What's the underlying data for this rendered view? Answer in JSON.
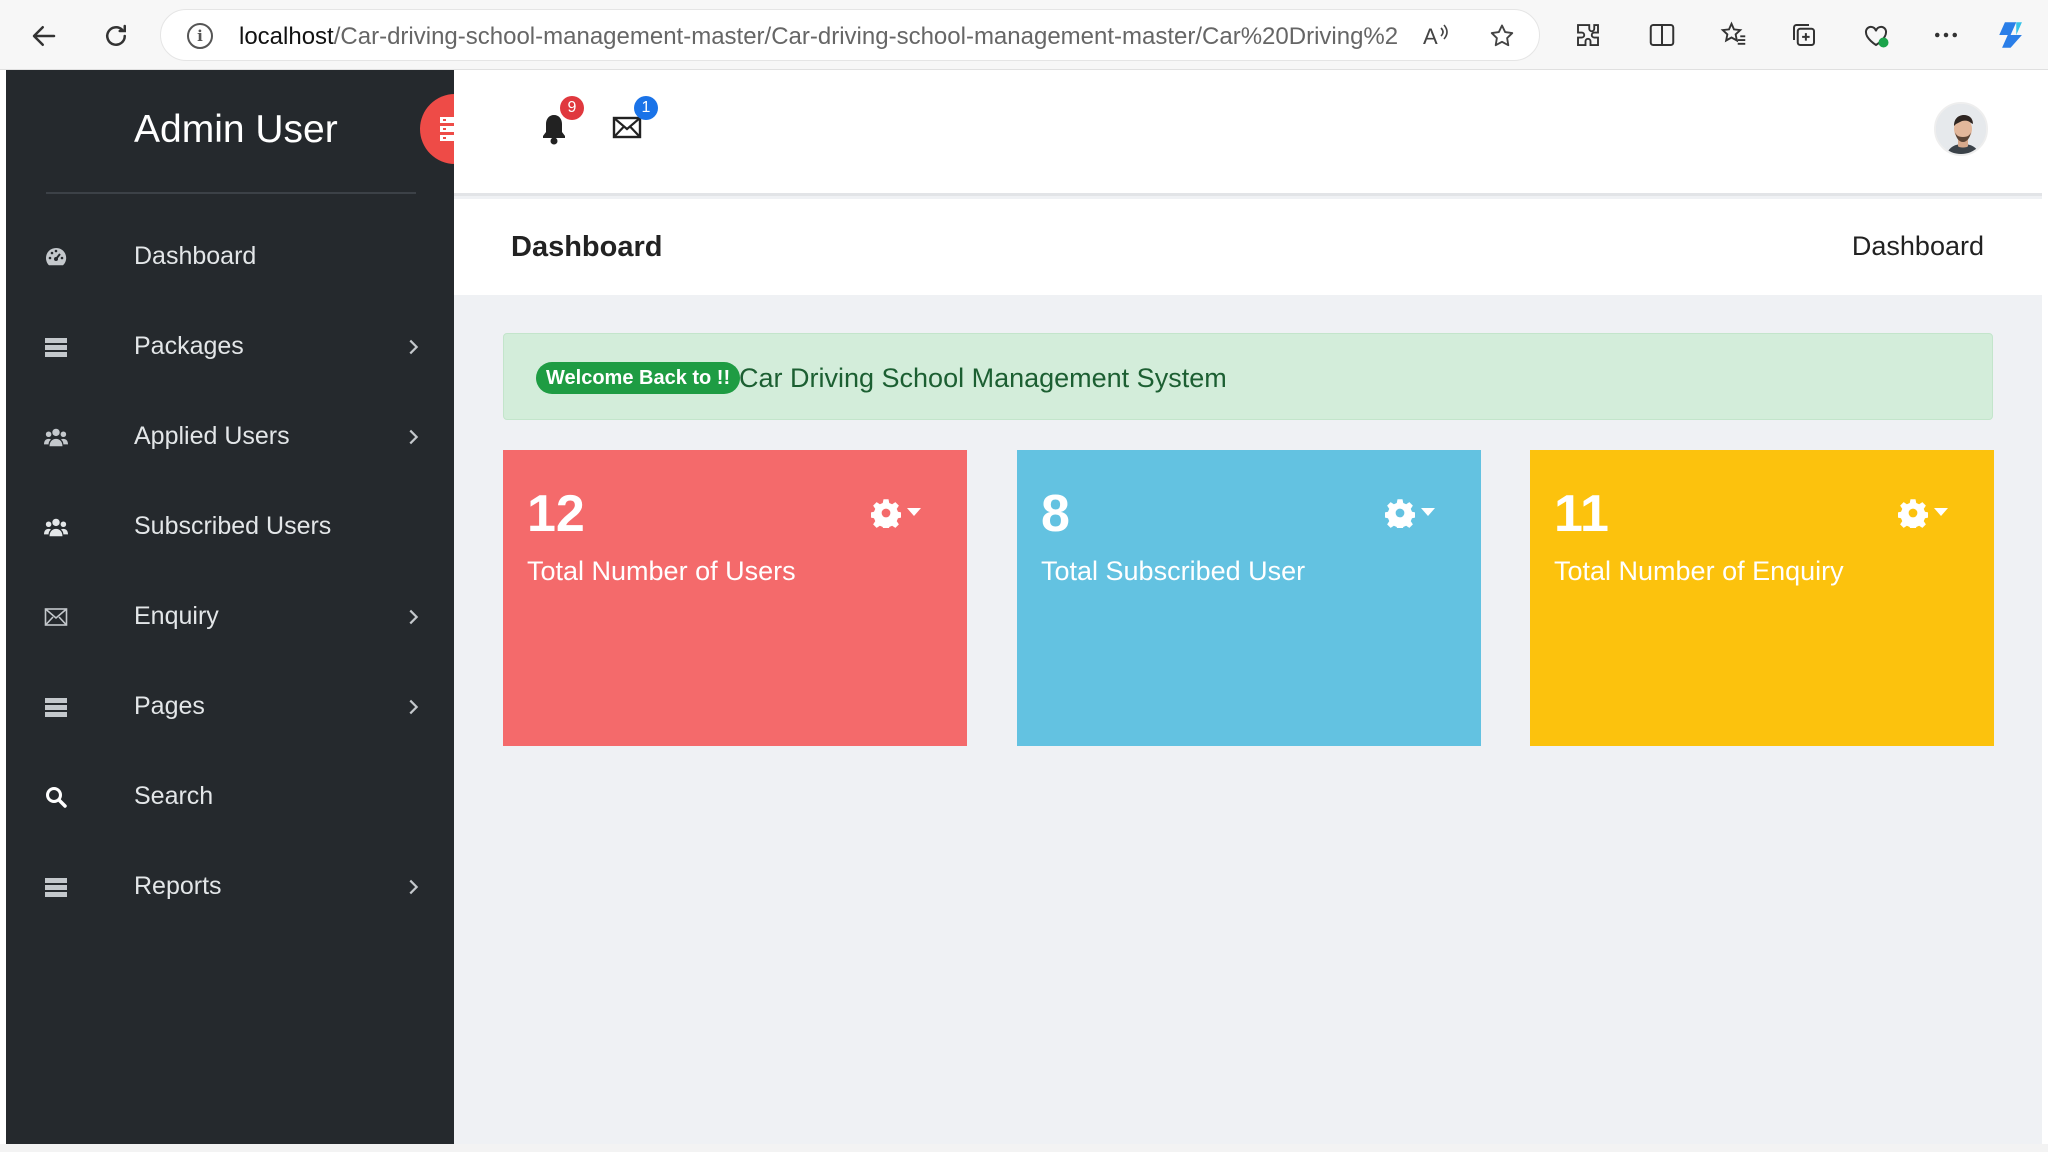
{
  "browser": {
    "url_host": "localhost",
    "url_path": "/Car-driving-school-management-master/Car-driving-school-management-master/Car%20Driving%20Sch..."
  },
  "sidebar": {
    "brand": "Admin User",
    "items": [
      {
        "label": "Dashboard",
        "icon": "dashboard-icon",
        "has_submenu": false
      },
      {
        "label": "Packages",
        "icon": "list-icon",
        "has_submenu": true
      },
      {
        "label": "Applied Users",
        "icon": "users-icon",
        "has_submenu": true
      },
      {
        "label": "Subscribed Users",
        "icon": "users-icon",
        "has_submenu": false
      },
      {
        "label": "Enquiry",
        "icon": "envelope-icon",
        "has_submenu": true
      },
      {
        "label": "Pages",
        "icon": "list-icon",
        "has_submenu": true
      },
      {
        "label": "Search",
        "icon": "search-icon",
        "has_submenu": false
      },
      {
        "label": "Reports",
        "icon": "list-icon",
        "has_submenu": true
      }
    ]
  },
  "header": {
    "notifications_count": "9",
    "messages_count": "1"
  },
  "page": {
    "title": "Dashboard",
    "breadcrumb": "Dashboard"
  },
  "alert": {
    "badge": "Welcome Back to !!",
    "text": "Car Driving School Management System"
  },
  "cards": [
    {
      "value": "12",
      "label": "Total Number of Users",
      "color": "#f46a6b"
    },
    {
      "value": "8",
      "label": "Total Subscribed User",
      "color": "#63c2e1"
    },
    {
      "value": "11",
      "label": "Total Number of Enquiry",
      "color": "#fcc20d"
    }
  ],
  "colors": {
    "sidebar_bg": "#25292d",
    "toggle_button": "#ee4b47",
    "badge_red": "#e0383e",
    "badge_blue": "#1a73e8",
    "alert_green": "#1e9c43"
  }
}
